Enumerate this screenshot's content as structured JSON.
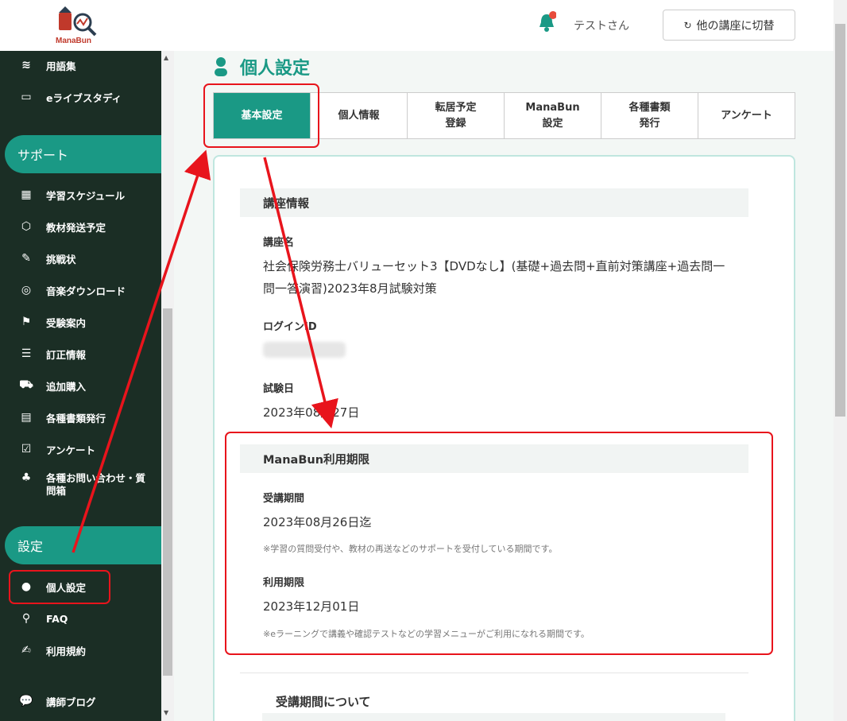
{
  "header": {
    "logo_text": "ManaBun",
    "user_name": "テストさん",
    "switch_label": "他の講座に切替"
  },
  "sidebar": {
    "top_items": [
      {
        "label": "用語集",
        "icon": "layers-icon"
      },
      {
        "label": "eライブスタディ",
        "icon": "monitor-icon"
      }
    ],
    "support_section": "サポート",
    "support_items": [
      {
        "label": "学習スケジュール",
        "icon": "calendar-icon"
      },
      {
        "label": "教材発送予定",
        "icon": "box-icon"
      },
      {
        "label": "挑戦状",
        "icon": "pen-icon"
      },
      {
        "label": "音楽ダウンロード",
        "icon": "disc-icon"
      },
      {
        "label": "受験案内",
        "icon": "flag-icon"
      },
      {
        "label": "訂正情報",
        "icon": "list-icon"
      },
      {
        "label": "追加購入",
        "icon": "cart-icon"
      },
      {
        "label": "各種書類発行",
        "icon": "document-icon"
      },
      {
        "label": "アンケート",
        "icon": "checkbox-icon"
      },
      {
        "label": "各種お問い合わせ・質問箱",
        "icon": "tree-icon"
      }
    ],
    "settings_section": "設定",
    "settings_items": [
      {
        "label": "個人設定",
        "icon": "person-icon"
      },
      {
        "label": "FAQ",
        "icon": "search-icon"
      },
      {
        "label": "利用規約",
        "icon": "edit-icon"
      }
    ],
    "bottom_items": [
      {
        "label": "講師ブログ",
        "icon": "chat-icon"
      }
    ]
  },
  "main": {
    "title": "個人設定",
    "tabs": [
      {
        "label": "基本設定",
        "active": true
      },
      {
        "label": "個人情報",
        "active": false
      },
      {
        "label": "転居予定\n登録",
        "active": false
      },
      {
        "label": "ManaBun\n設定",
        "active": false
      },
      {
        "label": "各種書類\n発行",
        "active": false
      },
      {
        "label": "アンケート",
        "active": false
      }
    ],
    "course_info": {
      "heading": "講座情報",
      "course_name_label": "講座名",
      "course_name": "社会保険労務士バリューセット3【DVDなし】(基礎+過去問+直前対策講座+過去問一問一答演習)2023年8月試験対策",
      "login_id_label": "ログインID",
      "exam_date_label": "試験日",
      "exam_date": "2023年08月27日"
    },
    "usage_period": {
      "heading": "ManaBun利用期限",
      "study_period_label": "受講期間",
      "study_period": "2023年08月26日迄",
      "study_period_note": "※学習の質問受付や、教材の再送などのサポートを受付している期間です。",
      "usage_limit_label": "利用期限",
      "usage_limit": "2023年12月01日",
      "usage_limit_note": "※eラーニングで講義や確認テストなどの学習メニューがご利用になれる期間です。"
    },
    "about_heading": "受講期間について"
  },
  "colors": {
    "accent": "#1a9985",
    "sidebar_bg": "#1b2e25",
    "annotation": "#e8141c"
  }
}
